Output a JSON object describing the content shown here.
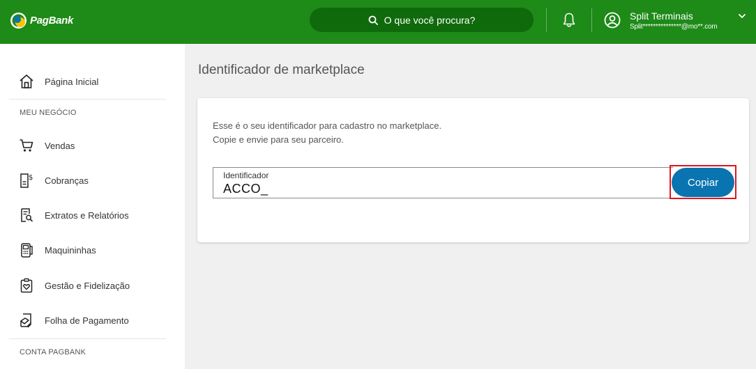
{
  "header": {
    "brand": "PagBank",
    "search_placeholder": "O que você procura?",
    "user_name": "Split Terminais",
    "user_email": "Split***************@mo**.com"
  },
  "sidebar": {
    "home": "Página Inicial",
    "section_business": "MEU NEGÓCIO",
    "items": [
      {
        "label": "Vendas",
        "icon": "cart-icon"
      },
      {
        "label": "Cobranças",
        "icon": "invoice-dollar-icon"
      },
      {
        "label": "Extratos e Relatórios",
        "icon": "statement-search-icon"
      },
      {
        "label": "Maquininhas",
        "icon": "card-machine-icon"
      },
      {
        "label": "Gestão e Fidelização",
        "icon": "clipboard-heart-icon"
      },
      {
        "label": "Folha de Pagamento",
        "icon": "payroll-icon"
      }
    ],
    "section_account": "CONTA PAGBANK"
  },
  "main": {
    "title": "Identificador de marketplace",
    "description_line1": "Esse é o seu identificador para cadastro no marketplace.",
    "description_line2": "Copie e envie para seu parceiro.",
    "field_label": "Identificador",
    "field_value": "ACCO_",
    "copy_button": "Copiar"
  },
  "colors": {
    "header_green": "#1e8a18",
    "search_green": "#0f6a0b",
    "button_blue": "#0a74b0",
    "highlight_red": "#e0141e"
  }
}
